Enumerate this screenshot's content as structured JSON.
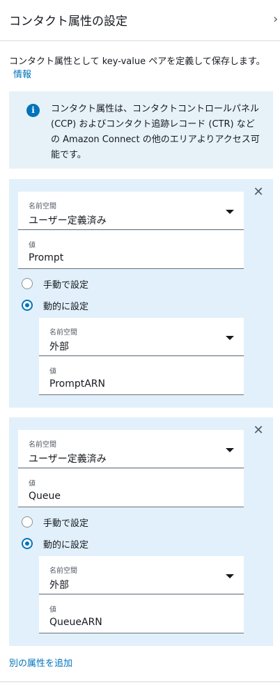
{
  "header": {
    "title": "コンタクト属性の設定",
    "close_icon": "chevron-right-icon"
  },
  "description": {
    "text": "コンタクト属性として key-value ペアを定義して保存します。",
    "info_link": "情報"
  },
  "info_box": {
    "icon": "info-icon",
    "text": "コンタクト属性は、コンタクトコントロールパネル (CCP) およびコンタクト追跡レコード (CTR) などの Amazon Connect の他のエリアよりアクセス可能です。"
  },
  "attributes": [
    {
      "namespace_label": "名前空間",
      "namespace_value": "ユーザー定義済み",
      "value_label": "値",
      "value_value": "Prompt",
      "radio_manual": "手動で設定",
      "radio_dynamic": "動的に設定",
      "selected": "dynamic",
      "dyn_namespace_label": "名前空間",
      "dyn_namespace_value": "外部",
      "dyn_value_label": "値",
      "dyn_value_value": "PromptARN"
    },
    {
      "namespace_label": "名前空間",
      "namespace_value": "ユーザー定義済み",
      "value_label": "値",
      "value_value": "Queue",
      "radio_manual": "手動で設定",
      "radio_dynamic": "動的に設定",
      "selected": "dynamic",
      "dyn_namespace_label": "名前空間",
      "dyn_namespace_value": "外部",
      "dyn_value_label": "値",
      "dyn_value_value": "QueueARN"
    }
  ],
  "add_attribute_link": "別の属性を追加",
  "colors": {
    "link": "#0073bb",
    "card_bg": "#e1f0fa",
    "info_bg": "#e6f2f8"
  }
}
